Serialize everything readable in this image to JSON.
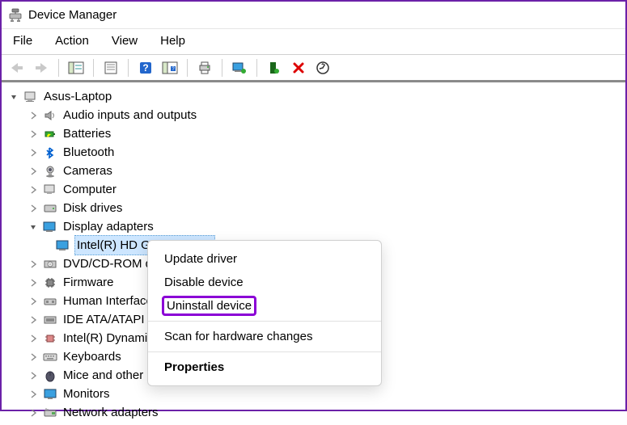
{
  "window": {
    "title": "Device Manager"
  },
  "menu": {
    "file": "File",
    "action": "Action",
    "view": "View",
    "help": "Help"
  },
  "tree": {
    "root": "Asus-Laptop",
    "items": [
      {
        "label": "Audio inputs and outputs",
        "exp": "collapsed"
      },
      {
        "label": "Batteries",
        "exp": "collapsed"
      },
      {
        "label": "Bluetooth",
        "exp": "collapsed"
      },
      {
        "label": "Cameras",
        "exp": "collapsed"
      },
      {
        "label": "Computer",
        "exp": "collapsed"
      },
      {
        "label": "Disk drives",
        "exp": "collapsed"
      },
      {
        "label": "Display adapters",
        "exp": "expanded"
      },
      {
        "label": "DVD/CD-ROM d",
        "exp": "collapsed"
      },
      {
        "label": "Firmware",
        "exp": "collapsed"
      },
      {
        "label": "Human Interface",
        "exp": "collapsed"
      },
      {
        "label": "IDE ATA/ATAPI co",
        "exp": "collapsed"
      },
      {
        "label": "Intel(R) Dynamic",
        "exp": "collapsed"
      },
      {
        "label": "Keyboards",
        "exp": "collapsed"
      },
      {
        "label": "Mice and other",
        "exp": "collapsed"
      },
      {
        "label": "Monitors",
        "exp": "collapsed"
      },
      {
        "label": "Network adapters",
        "exp": "collapsed"
      }
    ],
    "selected_child": "Intel(R) HD Graphics 620"
  },
  "context_menu": {
    "update": "Update driver",
    "disable": "Disable device",
    "uninstall": "Uninstall device",
    "scan": "Scan for hardware changes",
    "properties": "Properties"
  }
}
